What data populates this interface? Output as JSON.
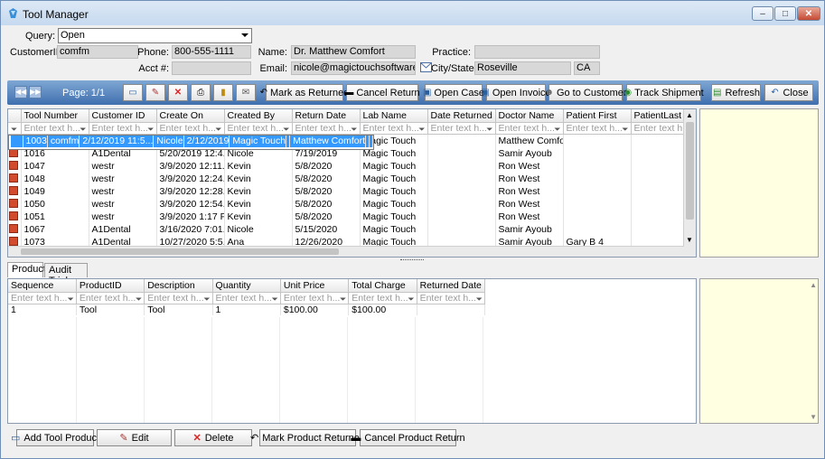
{
  "window": {
    "title": "Tool Manager",
    "minimize": "–",
    "maximize": "□",
    "close": "✕"
  },
  "form": {
    "query_label": "Query:",
    "query_value": "Open",
    "customer_id_label": "CustomerID:",
    "customer_id": "comfm",
    "phone_label": "Phone:",
    "phone": "800-555-1111",
    "acct_label": "Acct #:",
    "acct": "",
    "name_label": "Name:",
    "name": "Dr. Matthew Comfort",
    "email_label": "Email:",
    "email": "nicole@magictouchsoftware.com",
    "practice_label": "Practice:",
    "practice": "",
    "city_label": "City/State:",
    "city": "Roseville",
    "state": "CA"
  },
  "toolbar": {
    "page": "Page: 1/1",
    "mark_returned": "Mark as Returned",
    "cancel_return": "Cancel Return",
    "open_case": "Open Case",
    "open_invoice": "Open Invoice",
    "go_to_customer": "Go to Customer",
    "track_shipment": "Track Shipment",
    "refresh": "Refresh",
    "close": "Close"
  },
  "filter_placeholder": "Enter text h...",
  "tools_grid": {
    "columns": [
      "Tool Number",
      "Customer ID",
      "Create On",
      "Created By",
      "Return Date",
      "Lab Name",
      "Date Returned",
      "Doctor Name",
      "Patient First",
      "PatientLast"
    ],
    "rows": [
      [
        "1003",
        "comfm",
        "2/12/2019 11:5...",
        "Nicole",
        "2/12/2019",
        "Magic Touch",
        "",
        "Matthew Comfort",
        "",
        ""
      ],
      [
        "1004",
        "comfm",
        "2/12/2019 11:5...",
        "Nicole",
        "4/13/2019",
        "Magic Touch",
        "",
        "Matthew Comfort",
        "",
        ""
      ],
      [
        "1016",
        "A1Dental",
        "5/20/2019 12:4...",
        "Nicole",
        "7/19/2019",
        "Magic Touch",
        "",
        "Samir Ayoub",
        "",
        ""
      ],
      [
        "1047",
        "westr",
        "3/9/2020 12:11...",
        "Kevin",
        "5/8/2020",
        "Magic Touch",
        "",
        "Ron West",
        "",
        ""
      ],
      [
        "1048",
        "westr",
        "3/9/2020 12:24...",
        "Kevin",
        "5/8/2020",
        "Magic Touch",
        "",
        "Ron West",
        "",
        ""
      ],
      [
        "1049",
        "westr",
        "3/9/2020 12:28...",
        "Kevin",
        "5/8/2020",
        "Magic Touch",
        "",
        "Ron West",
        "",
        ""
      ],
      [
        "1050",
        "westr",
        "3/9/2020 12:54...",
        "Kevin",
        "5/8/2020",
        "Magic Touch",
        "",
        "Ron West",
        "",
        ""
      ],
      [
        "1051",
        "westr",
        "3/9/2020 1:17 PM",
        "Kevin",
        "5/8/2020",
        "Magic Touch",
        "",
        "Ron West",
        "",
        ""
      ],
      [
        "1067",
        "A1Dental",
        "3/16/2020 7:01...",
        "Nicole",
        "5/15/2020",
        "Magic Touch",
        "",
        "Samir Ayoub",
        "",
        ""
      ],
      [
        "1073",
        "A1Dental",
        "10/27/2020 5:5...",
        "Ana",
        "12/26/2020",
        "Magic Touch",
        "",
        "Samir Ayoub",
        "Gary B 4",
        ""
      ]
    ]
  },
  "tabs": [
    "Products",
    "Audit Trial"
  ],
  "products_grid": {
    "columns": [
      "Sequence",
      "ProductID",
      "Description",
      "Quantity",
      "Unit Price",
      "Total Charge",
      "Returned Date"
    ],
    "rows": [
      [
        "1",
        "Tool",
        "Tool",
        "1",
        "$100.00",
        "$100.00",
        ""
      ]
    ]
  },
  "bottom": {
    "add": "Add Tool Product",
    "edit": "Edit",
    "delete": "Delete",
    "mark_product_returned": "Mark Product Returned",
    "cancel_product_return": "Cancel Product Return"
  }
}
